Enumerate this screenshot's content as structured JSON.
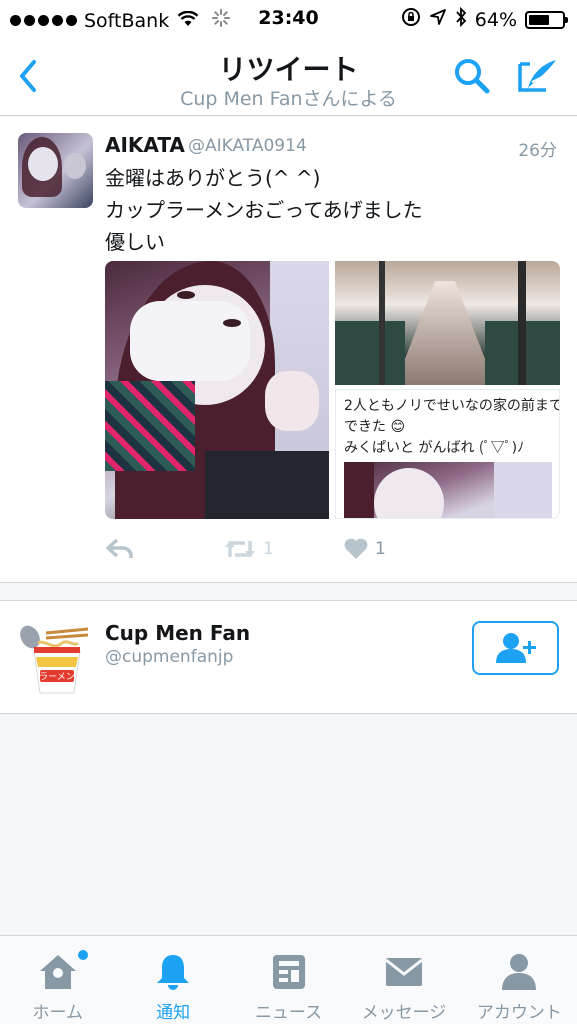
{
  "status_bar": {
    "carrier": "SoftBank",
    "time": "23:40",
    "battery": "64%",
    "battery_level": 0.64
  },
  "nav": {
    "title": "リツイート",
    "subtitle": "Cup Men Fanさんによる",
    "icons": [
      "chevron-left-icon",
      "search-icon",
      "compose-tweet-icon"
    ]
  },
  "tweet": {
    "name": "AIKATA",
    "handle": "@AIKATA0914",
    "time": "26分",
    "text": [
      "金曜はありがとう(^ ^)",
      "カップラーメンおごってあげました",
      "優しい"
    ],
    "media_caption": [
      "2人ともノリでせいなの家の前まで",
      "できた 😊",
      "みくぱいと がんばれ (ﾟ▽ﾟ)ﾉ"
    ],
    "retweets": "1",
    "likes": "1"
  },
  "user": {
    "name": "Cup Men Fan",
    "handle": "@cupmenfanjp",
    "ramen_label": "ラーメン"
  },
  "tabs": [
    {
      "label": "ホーム",
      "icon": "home-icon",
      "active": false
    },
    {
      "label": "通知",
      "icon": "bell-icon",
      "active": true
    },
    {
      "label": "ニュース",
      "icon": "news-icon",
      "active": false
    },
    {
      "label": "メッセージ",
      "icon": "envelope-icon",
      "active": false
    },
    {
      "label": "アカウント",
      "icon": "person-icon",
      "active": false
    }
  ],
  "colors": {
    "accent": "#1da1f2",
    "muted": "#8899a6",
    "text": "#14171a"
  }
}
